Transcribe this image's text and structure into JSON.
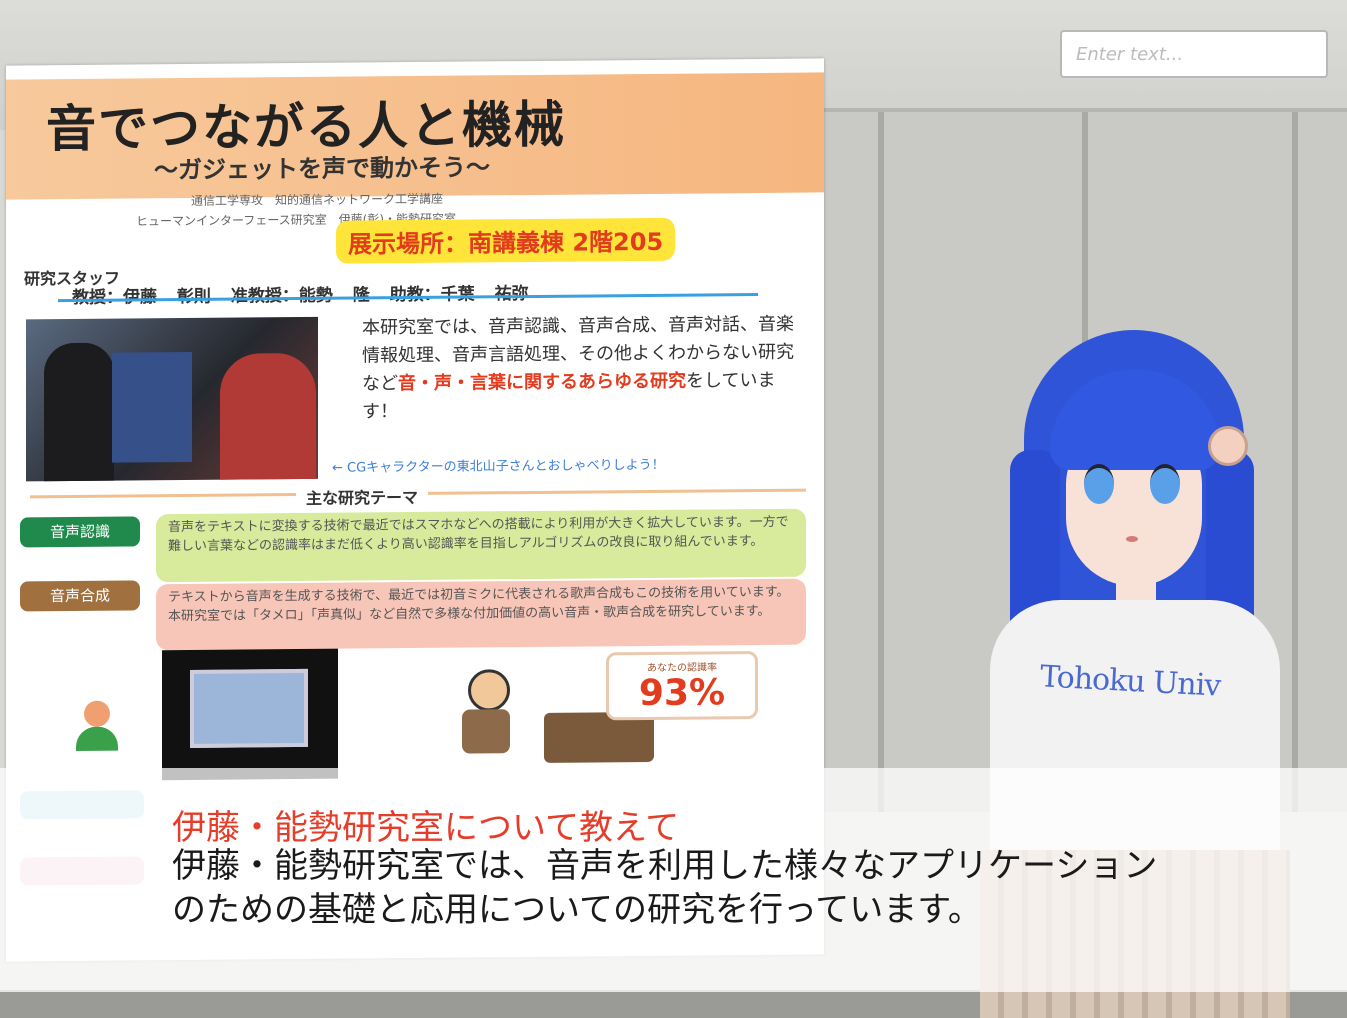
{
  "text_input": {
    "placeholder": "Enter text...",
    "value": ""
  },
  "poster": {
    "title": "音でつながる人と機械",
    "subtitle": "〜ガジェットを声で動かそう〜",
    "affiliation_1": "通信工学専攻　知的通信ネットワーク工学講座",
    "affiliation_2": "ヒューマンインターフェース研究室　伊藤(彰)・能勢研究室",
    "location": "展示場所：南講義棟 2階205",
    "staff_heading": "研究スタッフ",
    "staff": "教授：伊藤 彰則 准教授：能勢 隆 助教：千葉 祐弥",
    "intro_1": "本研究室では、音声認識、音声合成、音声対話、音楽情報処理、音声言語処理、その他よくわからない研究など",
    "intro_highlight": "音・声・言葉に関するあらゆる研究",
    "intro_2": "をしています！",
    "cg_note": "← CGキャラクターの東北山子さんとおしゃべりしよう！",
    "themes_heading": "主な研究テーマ",
    "themes": [
      {
        "label": "音声認識",
        "color": "#1f8a4c",
        "description": "音声をテキストに変換する技術で最近ではスマホなどへの搭載により利用が大きく拡大しています。一方で難しい言葉などの認識率はまだ低くより高い認識率を目指しアルゴリズムの改良に取り組んでいます。"
      },
      {
        "label": "音声合成",
        "color": "#a0703e",
        "description": "テキストから音声を生成する技術で、最近では初音ミクに代表される歌声合成もこの技術を用いています。本研究室では「タメロ」「声真似」など自然で多様な付加価値の高い音声・歌声合成を研究しています。"
      }
    ],
    "stat": {
      "caption": "あなたの認識率",
      "value": "93%"
    }
  },
  "avatar": {
    "shirt_text": "Tohoku Univ"
  },
  "dialog": {
    "question": "伊藤・能勢研究室について教えて",
    "answer": "伊藤・能勢研究室では、音声を利用した様々なアプリケーションのための基礎と応用についての研究を行っています。"
  }
}
